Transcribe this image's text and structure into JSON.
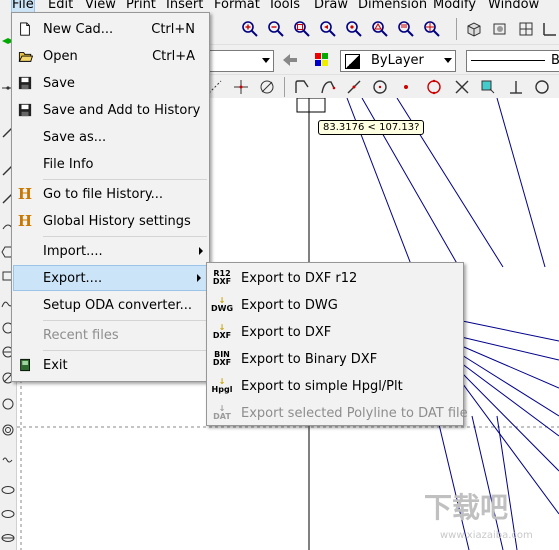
{
  "menubar": {
    "items": [
      "File",
      "Edit",
      "View",
      "Print",
      "Insert",
      "Format",
      "Tools",
      "Draw",
      "Dimension",
      "Modify",
      "Window"
    ]
  },
  "toolbar": {
    "layer_select": "",
    "color_select": "ByLayer",
    "linetype_prefix": "B"
  },
  "coord_tooltip": "83.3176 < 107.13?",
  "file_menu": {
    "items": [
      {
        "label": "New Cad...",
        "shortcut": "Ctrl+N",
        "icon": "new-file-icon"
      },
      {
        "label": "Open",
        "shortcut": "Ctrl+A",
        "icon": "open-folder-icon"
      },
      {
        "label": "Save",
        "shortcut": "",
        "icon": "save-disk-icon"
      },
      {
        "label": "Save and Add to History",
        "shortcut": "",
        "icon": "save-disk-icon"
      },
      {
        "label": "Save as...",
        "shortcut": "",
        "icon": ""
      },
      {
        "label": "File Info",
        "shortcut": "",
        "icon": ""
      },
      {
        "label": "Go to file History...",
        "shortcut": "",
        "icon": "history-h-icon"
      },
      {
        "label": "Global History settings",
        "shortcut": "",
        "icon": "history-h-icon"
      },
      {
        "label": "Import....",
        "shortcut": "",
        "icon": ""
      },
      {
        "label": "Export....",
        "shortcut": "",
        "icon": ""
      },
      {
        "label": "Setup ODA converter...",
        "shortcut": "",
        "icon": ""
      },
      {
        "label": "Recent files",
        "shortcut": "",
        "icon": ""
      },
      {
        "label": "Exit",
        "shortcut": "",
        "icon": "exit-icon"
      }
    ]
  },
  "export_menu": {
    "items": [
      {
        "label": "Export to DXF  r12",
        "icon_top": "R12",
        "icon_bottom": "DXF"
      },
      {
        "label": "Export to DWG",
        "icon_top": "↓",
        "icon_bottom": "DWG"
      },
      {
        "label": "Export to DXF",
        "icon_top": "↓",
        "icon_bottom": "DXF"
      },
      {
        "label": "Export to Binary DXF",
        "icon_top": "BIN",
        "icon_bottom": "DXF"
      },
      {
        "label": "Export to simple Hpgl/Plt",
        "icon_top": "↓",
        "icon_bottom": "Hpgl"
      },
      {
        "label": "Export selected Polyline to DAT file",
        "icon_top": "↓",
        "icon_bottom": "DAT"
      }
    ]
  },
  "watermark": {
    "cn": "下载吧",
    "url": "www.xiazaiba.com"
  }
}
